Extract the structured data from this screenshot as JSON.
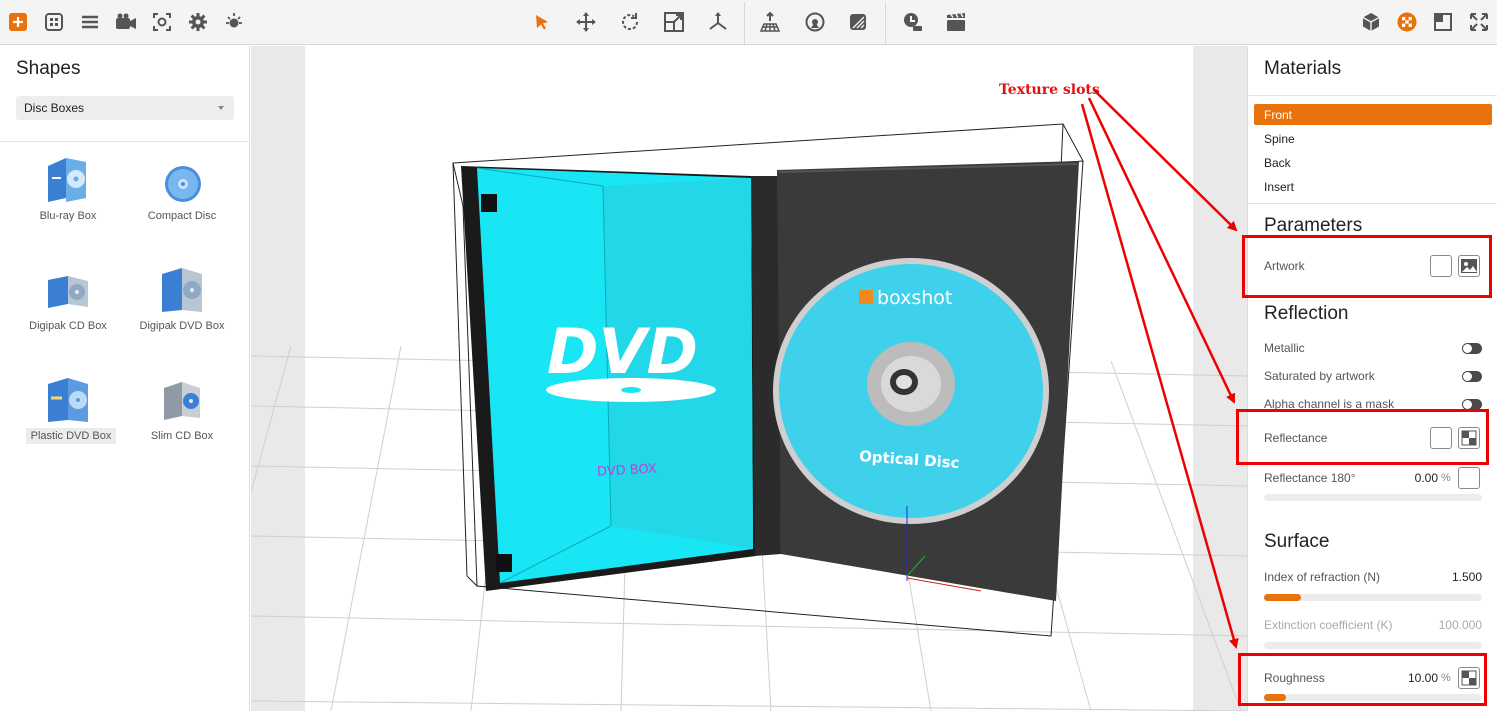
{
  "colors": {
    "accent": "#e8720c",
    "annotation": "#ee0000",
    "dvd_blue": "#19e6f5"
  },
  "toolbar": {
    "left_icons": [
      "add-icon",
      "grid-icon",
      "list-icon",
      "camera-icon",
      "snapshot-icon",
      "gear-icon",
      "light-icon"
    ],
    "center_icons": [
      "select-arrow-icon",
      "move-icon",
      "rotate-icon",
      "scale-icon",
      "axes-icon",
      "floor-icon",
      "target-icon",
      "texture-icon",
      "timer-icon",
      "clapper-icon"
    ],
    "right_icons": [
      "cube-icon",
      "materials-icon",
      "window-icon",
      "fullscreen-icon"
    ]
  },
  "shapes": {
    "title": "Shapes",
    "category": "Disc Boxes",
    "items": [
      {
        "label": "Blu-ray Box",
        "icon": "bluray-box-icon"
      },
      {
        "label": "Compact Disc",
        "icon": "compact-disc-icon"
      },
      {
        "label": "Digipak CD Box",
        "icon": "digipak-cd-icon"
      },
      {
        "label": "Digipak DVD Box",
        "icon": "digipak-dvd-icon"
      },
      {
        "label": "Plastic DVD Box",
        "icon": "plastic-dvd-icon"
      },
      {
        "label": "Slim CD Box",
        "icon": "slim-cd-icon"
      }
    ]
  },
  "viewport": {
    "dvd_logo": "DVD",
    "box_label": "DVD BOX",
    "disc_brand": "boxshot",
    "disc_label": "Optical Disc"
  },
  "materials": {
    "title": "Materials",
    "items": [
      "Front",
      "Spine",
      "Back",
      "Insert"
    ],
    "active": "Front"
  },
  "parameters": {
    "title": "Parameters",
    "artwork_label": "Artwork"
  },
  "reflection": {
    "title": "Reflection",
    "metallic": "Metallic",
    "saturated": "Saturated by artwork",
    "alpha": "Alpha channel is a mask",
    "reflectance": "Reflectance",
    "reflectance180": "Reflectance 180°",
    "reflectance180_value": "0.00",
    "unit": "%"
  },
  "surface": {
    "title": "Surface",
    "ior_label": "Index of refraction (N)",
    "ior_value": "1.500",
    "ior_fill": 0.17,
    "ext_label": "Extinction coefficient (K)",
    "ext_value": "100.000",
    "ext_fill": 0,
    "roughness_label": "Roughness",
    "roughness_value": "10.00",
    "roughness_fill": 0.1,
    "unit": "%"
  },
  "annotation": {
    "label": "Texture slots"
  }
}
